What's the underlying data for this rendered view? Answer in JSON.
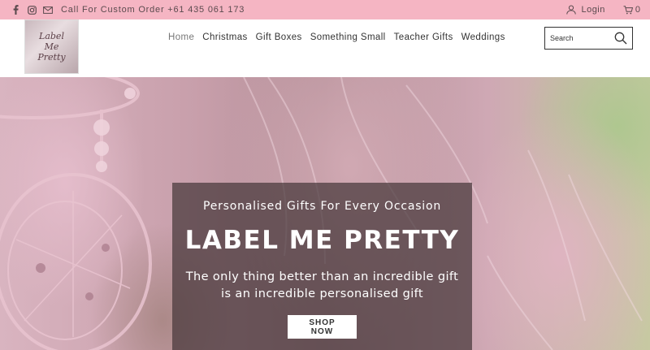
{
  "topbar": {
    "call_text": "Call For Custom Order +61 435 061 173",
    "login_label": "Login",
    "cart_count": "0",
    "social_icons": [
      "facebook-icon",
      "instagram-icon",
      "email-icon"
    ]
  },
  "header": {
    "logo_text": "Label Me Pretty",
    "nav": [
      "Home",
      "Christmas",
      "Gift Boxes",
      "Something Small",
      "Teacher Gifts",
      "Weddings"
    ],
    "search_placeholder": "Search"
  },
  "hero": {
    "kicker": "Personalised Gifts For Every Occasion",
    "title": "LABEL ME PRETTY",
    "tagline": "The only thing better than an incredible gift is an incredible personalised gift",
    "cta_label": "SHOP NOW"
  },
  "colors": {
    "topbar_bg": "#f5b5c3",
    "overlay_bg": "#46373a"
  }
}
